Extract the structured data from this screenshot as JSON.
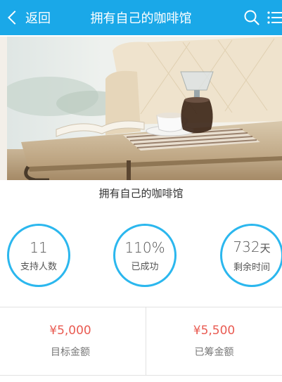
{
  "header": {
    "back_label": "返回",
    "title": "拥有自己的咖啡馆"
  },
  "project": {
    "title": "拥有自己的咖啡馆"
  },
  "stats": [
    {
      "value": "11",
      "unit": "",
      "label": "支持人数"
    },
    {
      "value": "110%",
      "unit": "",
      "label": "已成功"
    },
    {
      "value": "732",
      "unit": "天",
      "label": "剩余时间"
    }
  ],
  "funding": {
    "target_amount": "¥5,000",
    "target_label": "目标金额",
    "raised_amount": "¥5,500",
    "raised_label": "已筹金额"
  },
  "colors": {
    "accent": "#1aa8e8",
    "circle": "#2bb7ee",
    "amount": "#e95b52"
  }
}
